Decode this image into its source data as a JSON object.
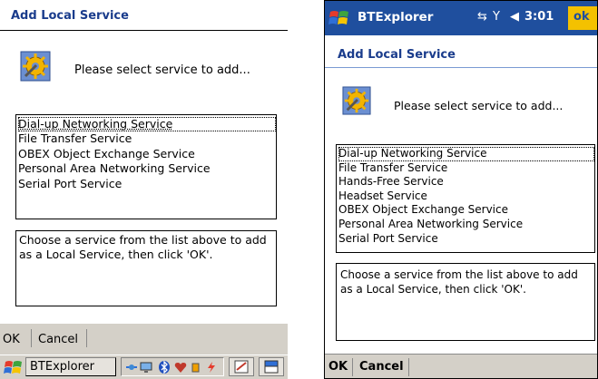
{
  "left": {
    "title": "Add Local Service",
    "prompt": "Please select service to add...",
    "services": [
      "Dial-up Networking Service",
      "File Transfer Service",
      "OBEX Object Exchange Service",
      "Personal Area Networking Service",
      "Serial Port Service"
    ],
    "description": "Choose a service from the list above to add as a Local Service, then click 'OK'.",
    "menu": {
      "ok": "OK",
      "cancel": "Cancel"
    },
    "taskbar": {
      "task_label": "BTExplorer"
    }
  },
  "right": {
    "app_title": "BTExplorer",
    "time": "3:01",
    "ok_button": "ok",
    "heading": "Add Local Service",
    "prompt": "Please select service to add...",
    "services": [
      "Dial-up Networking Service",
      "File Transfer Service",
      "Hands-Free Service",
      "Headset Service",
      "OBEX Object Exchange Service",
      "Personal Area Networking Service",
      "Serial Port Service"
    ],
    "description": "Choose a service from the list above to add as a Local Service, then click 'OK'.",
    "menu": {
      "ok": "OK",
      "cancel": "Cancel"
    }
  },
  "colors": {
    "title_bar": "#1f4f9e",
    "heading_text": "#1a3c8c",
    "ok_highlight": "#f4c100",
    "menu_bg": "#d4d0c8"
  },
  "icons": [
    "gear-service-icon",
    "windows-start-icon",
    "connectivity-icon",
    "signal-icon",
    "volume-icon",
    "bluetooth-icon"
  ]
}
